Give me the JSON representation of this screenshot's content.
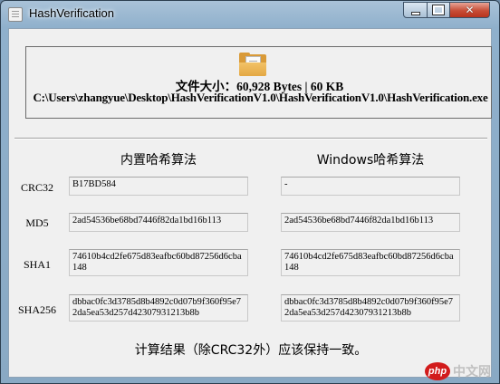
{
  "window": {
    "title": "HashVerification",
    "close_glyph": "✕"
  },
  "file": {
    "icon": "folder-icon",
    "size_line": "文件大小：60,928 Bytes | 60 KB",
    "path": "C:\\Users\\zhangyue\\Desktop\\HashVerificationV1.0\\HashVerificationV1.0\\HashVerification.exe"
  },
  "columns": {
    "builtin": "内置哈希算法",
    "windows": "Windows哈希算法"
  },
  "rows": [
    {
      "label": "CRC32",
      "builtin": "B17BD584",
      "windows": "-"
    },
    {
      "label": "MD5",
      "builtin": "2ad54536be68bd7446f82da1bd16b113",
      "windows": "2ad54536be68bd7446f82da1bd16b113"
    },
    {
      "label": "SHA1",
      "builtin": "74610b4cd2fe675d83eafbc60bd87256d6cba148",
      "windows": "74610b4cd2fe675d83eafbc60bd87256d6cba148"
    },
    {
      "label": "SHA256",
      "builtin": "dbbac0fc3d3785d8b4892c0d07b9f360f95e72da5ea53d257d42307931213b8b",
      "windows": "dbbac0fc3d3785d8b4892c0d07b9f360f95e72da5ea53d257d42307931213b8b"
    }
  ],
  "footer": "计算结果（除CRC32外）应该保持一致。",
  "watermark": {
    "badge": "php",
    "text": "中文网"
  }
}
